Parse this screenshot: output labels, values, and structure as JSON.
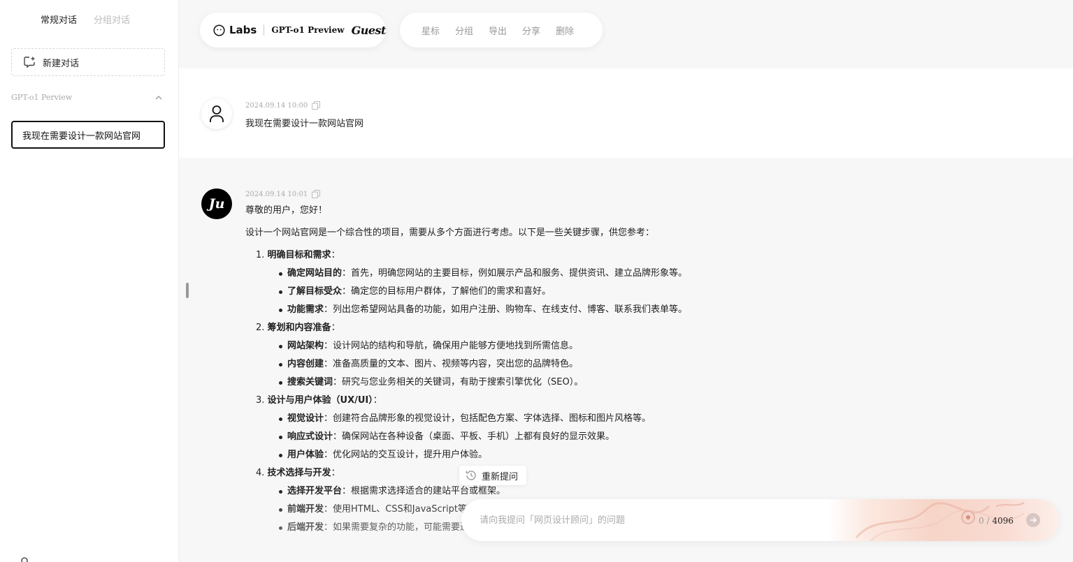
{
  "sidebar": {
    "tabs": [
      {
        "label": "常规对话",
        "active": true
      },
      {
        "label": "分组对话",
        "active": false
      }
    ],
    "new_chat_label": "新建对话",
    "group_label": "GPT-o1 Perview",
    "conversations": [
      {
        "title": "我现在需要设计一款网站官网",
        "active": true
      }
    ]
  },
  "header": {
    "brand": "Labs",
    "model": "GPT-o1 Preview",
    "user": "Guest",
    "actions": [
      "星标",
      "分组",
      "导出",
      "分享",
      "删除"
    ]
  },
  "messages": {
    "user": {
      "timestamp": "2024.09.14 10:00",
      "text": "我现在需要设计一款网站官网"
    },
    "bot": {
      "avatar_text": "Ju",
      "timestamp": "2024.09.14 10:01",
      "greeting": "尊敬的用户，您好！",
      "intro": "设计一个网站官网是一个综合性的项目，需要从多个方面进行考虑。以下是一些关键步骤，供您参考：",
      "sections": [
        {
          "num": "1.",
          "title": "明确目标和需求",
          "items": [
            {
              "term": "确定网站目的",
              "desc": "：首先，明确您网站的主要目标，例如展示产品和服务、提供资讯、建立品牌形象等。"
            },
            {
              "term": "了解目标受众",
              "desc": "：确定您的目标用户群体，了解他们的需求和喜好。"
            },
            {
              "term": "功能需求",
              "desc": "：列出您希望网站具备的功能，如用户注册、购物车、在线支付、博客、联系我们表单等。"
            }
          ]
        },
        {
          "num": "2.",
          "title": "筹划和内容准备",
          "items": [
            {
              "term": "网站架构",
              "desc": "：设计网站的结构和导航，确保用户能够方便地找到所需信息。"
            },
            {
              "term": "内容创建",
              "desc": "：准备高质量的文本、图片、视频等内容，突出您的品牌特色。"
            },
            {
              "term": "搜索关键词",
              "desc": "：研究与您业务相关的关键词，有助于搜索引擎优化（SEO）。"
            }
          ]
        },
        {
          "num": "3.",
          "title": "设计与用户体验（UX/UI）",
          "items": [
            {
              "term": "视觉设计",
              "desc": "：创建符合品牌形象的视觉设计，包括配色方案、字体选择、图标和图片风格等。"
            },
            {
              "term": "响应式设计",
              "desc": "：确保网站在各种设备（桌面、平板、手机）上都有良好的显示效果。"
            },
            {
              "term": "用户体验",
              "desc": "：优化网站的交互设计，提升用户体验。"
            }
          ]
        },
        {
          "num": "4.",
          "title": "技术选择与开发",
          "items": [
            {
              "term": "选择开发平台",
              "desc": "：根据需求选择适合的建站平台或框架。"
            },
            {
              "term": "前端开发",
              "desc": "：使用HTML、CSS和JavaScript等技术实现页面。"
            },
            {
              "term": "后端开发",
              "desc": "：如果需要复杂的功能，可能需要进行后端开发，使用语言如PHP、Python、Java等。"
            }
          ]
        }
      ]
    }
  },
  "reask_label": "重新提问",
  "input": {
    "placeholder": "请向我提问「网页设计顾问」的问题",
    "value": "",
    "count": "0",
    "max": "4096"
  }
}
